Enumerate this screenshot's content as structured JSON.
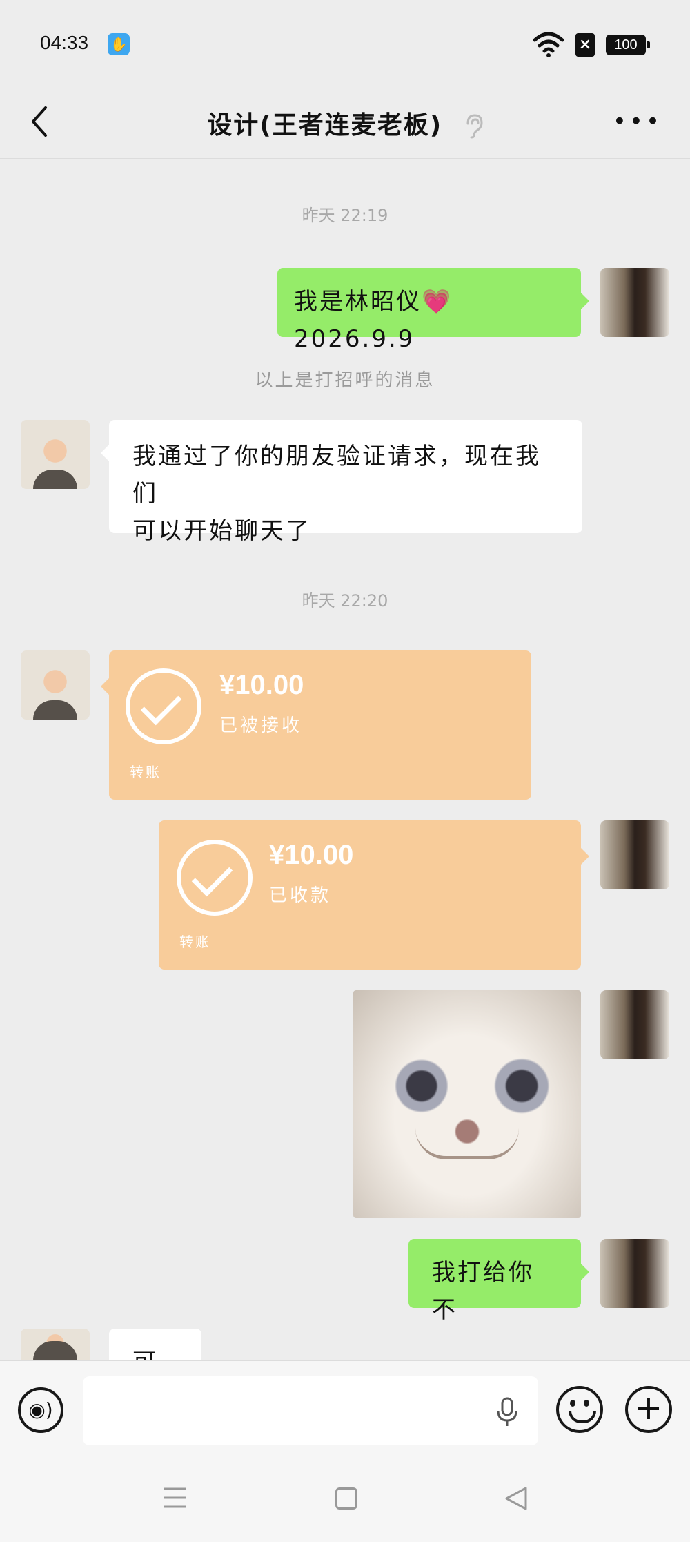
{
  "status_bar": {
    "time": "04:33",
    "battery": "100"
  },
  "header": {
    "title": "设计(王者连麦老板)"
  },
  "messages": {
    "ts1": "昨天 22:19",
    "msg1": "我是林昭仪💗2026.9.9",
    "system1": "以上是打招呼的消息",
    "msg2_line1": "我通过了你的朋友验证请求，现在我们",
    "msg2_line2": "可以开始聊天了",
    "ts2": "昨天 22:20",
    "transfer1": {
      "amount": "¥10.00",
      "status": "已被接收",
      "label": "转账"
    },
    "transfer2": {
      "amount": "¥10.00",
      "status": "已收款",
      "label": "转账"
    },
    "msg3": "我打给你不",
    "msg4_partial": "可"
  },
  "input": {
    "placeholder": ""
  },
  "colors": {
    "green_bubble": "#95ec69",
    "transfer": "#f8cc9a",
    "background": "#ededed"
  }
}
